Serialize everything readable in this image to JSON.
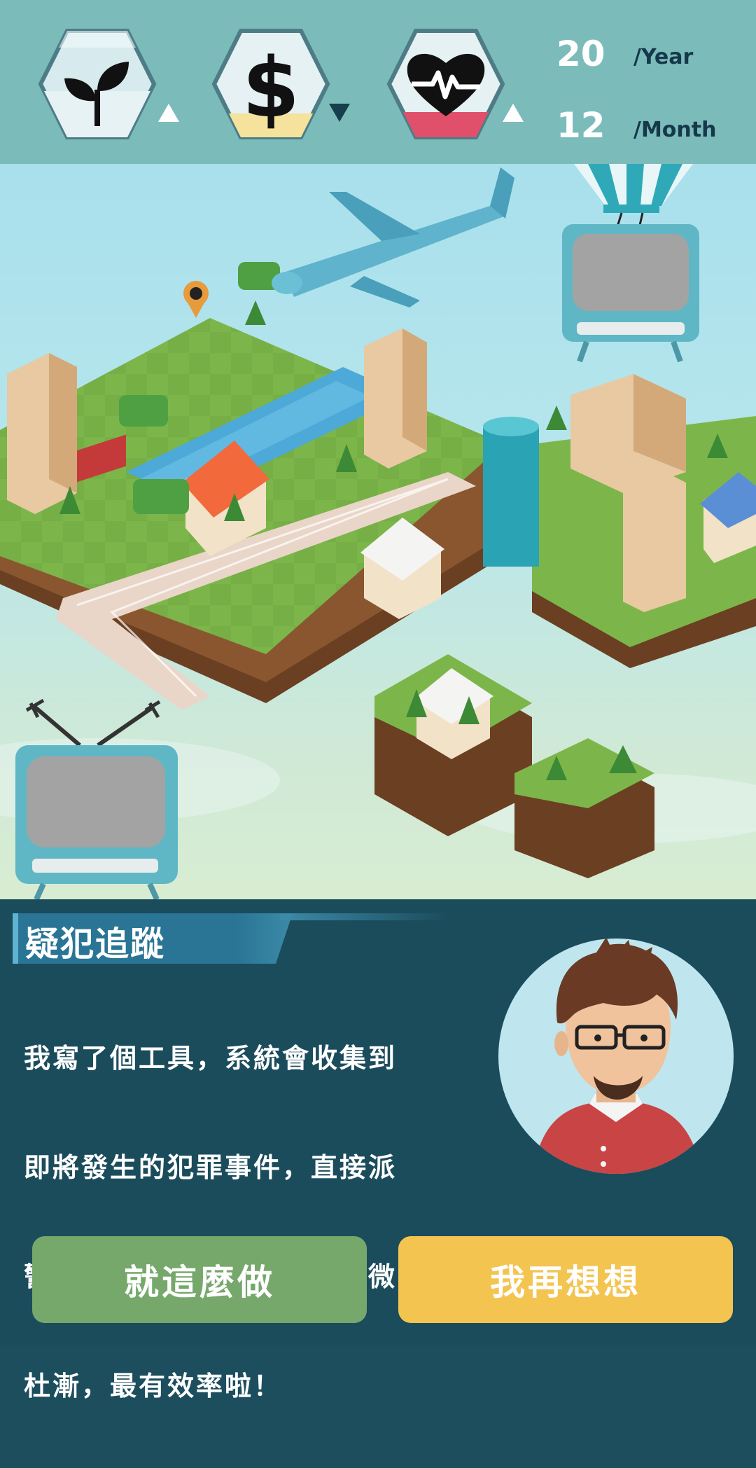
{
  "hud": {
    "stats": [
      {
        "icon": "sprout-icon",
        "trend": "up",
        "fill_color": "#e6f2f4"
      },
      {
        "icon": "dollar-icon",
        "trend": "down",
        "fill_color": "#f5e29c"
      },
      {
        "icon": "heartbeat-icon",
        "trend": "up",
        "fill_color": "#e0506a"
      }
    ],
    "year_value": "20",
    "year_unit": "/Year",
    "month_value": "12",
    "month_unit": "/Month"
  },
  "dialog": {
    "title": "疑犯追蹤",
    "lines": [
      "我寫了個工具，系統會收集到",
      "即將發生的犯罪事件，直接派",
      "警察把疑犯抓起來，這樣防微",
      "杜漸，最有效率啦！"
    ]
  },
  "buttons": {
    "accept_label": "就這麼做",
    "think_label": "我再想想"
  },
  "colors": {
    "hud_bg": "#7bbcbb",
    "panel_bg": "#1b4c5c",
    "accept_btn": "#76a86c",
    "think_btn": "#f4c451"
  }
}
